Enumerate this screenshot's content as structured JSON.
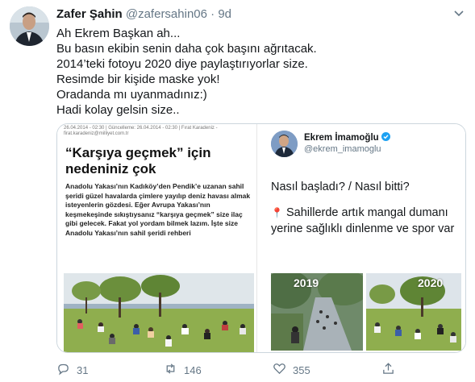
{
  "tweet": {
    "display_name": "Zafer Şahin",
    "handle": "@zafersahin06",
    "separator": "·",
    "time": "9d",
    "lines": [
      "Ah Ekrem Başkan ah...",
      "Bu basın ekibin senin daha çok başını ağrıtacak.",
      "2014’teki fotoyu 2020 diye paylaştırıyorlar size.",
      "Resimde bir kişide maske yok!",
      "Oradanda mı uyanmadınız:)",
      "Hadi kolay gelsin size.."
    ]
  },
  "newspaper": {
    "meta": "26.04.2014 - 02:30 | Güncelleme: 26.04.2014 - 02:30 | Fırat Karadeniz - firat.karadeniz@milliyet.com.tr",
    "title": "“Karşıya geçmek” için nedeniniz çok",
    "body": "Anadolu Yakası’nın Kadıköy’den Pendik’e uzanan sahil şeridi güzel havalarda çimlere yayılıp deniz havası almak isteyenlerin gözdesi. Eğer Avrupa Yakası’nın keşmekeşinde sıkıştıysanız “karşıya geçmek” size ilaç gibi gelecek. Fakat yol yordam bilmek lazım. İşte size Anadolu Yakası’nın sahil şeridi rehberi"
  },
  "quoted": {
    "name": "Ekrem İmamoğlu",
    "handle": "@ekrem_imamoglu",
    "line1": "Nasıl başladı?   /    Nasıl bitti?",
    "pin": "📍",
    "line2": "Sahillerde artık mangal dumanı yerine sağlıklı dinlenme ve spor var",
    "year_a": "2019",
    "year_b": "2020"
  },
  "actions": {
    "replies": "31",
    "retweets": "146",
    "likes": "355"
  }
}
